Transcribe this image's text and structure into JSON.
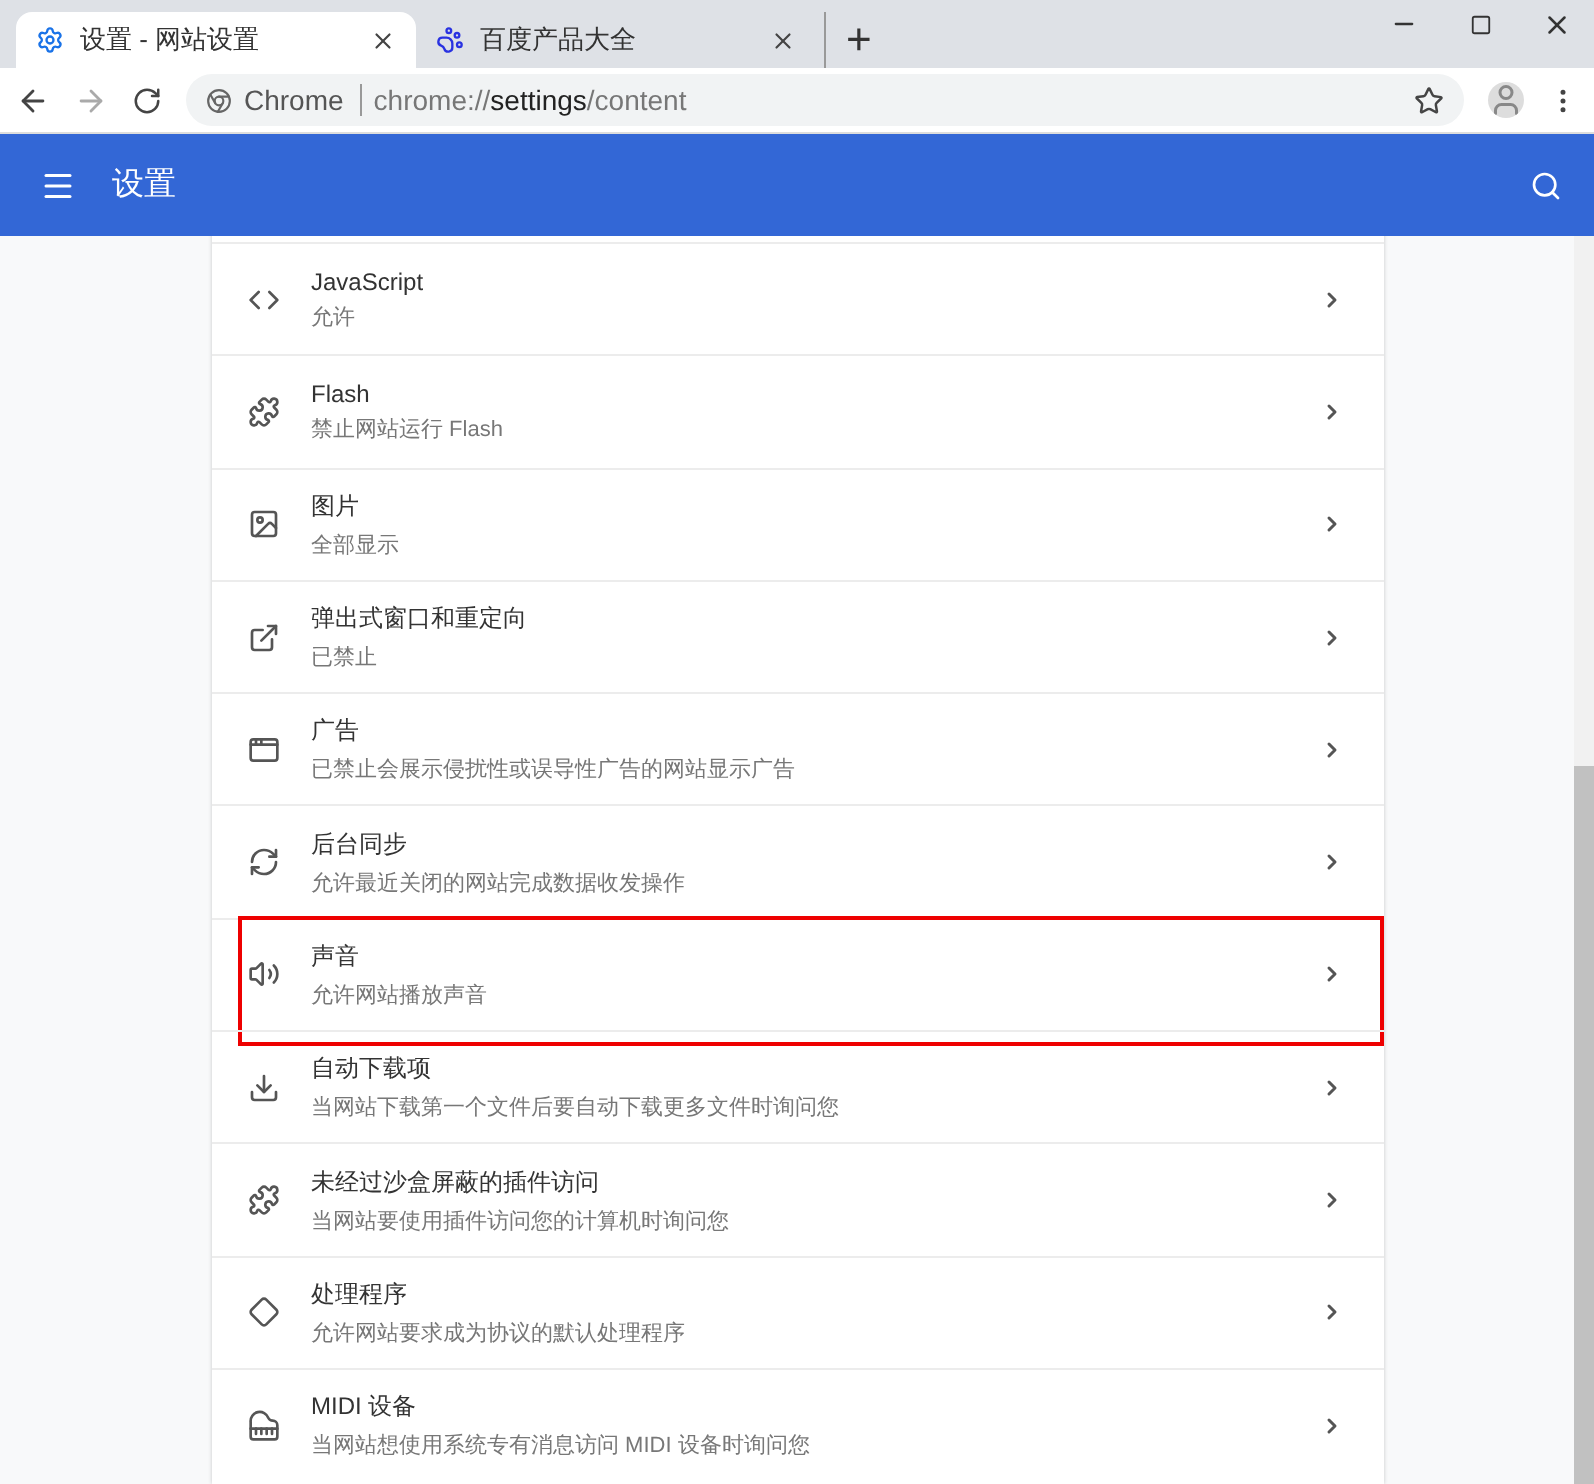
{
  "tabs": [
    {
      "title": "设置 - 网站设置",
      "kind": "settings",
      "selected": true
    },
    {
      "title": "百度产品大全",
      "kind": "paw",
      "selected": false
    }
  ],
  "new_tab": "+",
  "address_bar": {
    "origin_label": "Chrome",
    "scheme": "chrome://",
    "host": "settings",
    "path": "/content"
  },
  "header": {
    "title": "设置"
  },
  "rows": [
    {
      "kind": "code",
      "title": "JavaScript",
      "subtitle": "允许",
      "highlighted": false
    },
    {
      "kind": "puzzle",
      "title": "Flash",
      "subtitle": "禁止网站运行 Flash",
      "highlighted": false
    },
    {
      "kind": "image",
      "title": "图片",
      "subtitle": "全部显示",
      "highlighted": false
    },
    {
      "kind": "popup",
      "title": "弹出式窗口和重定向",
      "subtitle": "已禁止",
      "highlighted": false
    },
    {
      "kind": "window",
      "title": "广告",
      "subtitle": "已禁止会展示侵扰性或误导性广告的网站显示广告",
      "highlighted": false
    },
    {
      "kind": "sync",
      "title": "后台同步",
      "subtitle": "允许最近关闭的网站完成数据收发操作",
      "highlighted": false
    },
    {
      "kind": "sound",
      "title": "声音",
      "subtitle": "允许网站播放声音",
      "highlighted": true
    },
    {
      "kind": "download",
      "title": "自动下载项",
      "subtitle": "当网站下载第一个文件后要自动下载更多文件时询问您",
      "highlighted": false
    },
    {
      "kind": "puzzle",
      "title": "未经过沙盒屏蔽的插件访问",
      "subtitle": "当网站要使用插件访问您的计算机时询问您",
      "highlighted": false
    },
    {
      "kind": "handler",
      "title": "处理程序",
      "subtitle": "允许网站要求成为协议的默认处理程序",
      "highlighted": false
    },
    {
      "kind": "midi",
      "title": "MIDI 设备",
      "subtitle": "当网站想使用系统专有消息访问 MIDI 设备时询问您",
      "highlighted": false
    }
  ]
}
